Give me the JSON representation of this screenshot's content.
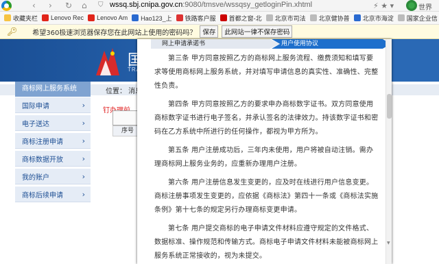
{
  "browser": {
    "url_host": "wssq.sbj.cnipa.gov.cn",
    "url_path": ":9080/tmsve/wssqsy_getloginPin.xhtml",
    "back": "‹",
    "forward": "›",
    "reload": "↻",
    "home": "⌂",
    "world_label": "世界"
  },
  "bookmarks": [
    {
      "label": "收藏夹栏",
      "color": "#f6c343"
    },
    {
      "label": "Lenovo Rec",
      "color": "#e1251b"
    },
    {
      "label": "Lenovo Am",
      "color": "#e1251b"
    },
    {
      "label": "Hao123_上",
      "color": "#2a6ad0"
    },
    {
      "label": "铁路客户服",
      "color": "#d33"
    },
    {
      "label": "首都之窗-北",
      "color": "#c00"
    },
    {
      "label": "北京市司法",
      "color": "#bbb"
    },
    {
      "label": "北京健协普",
      "color": "#bbb"
    },
    {
      "label": "北京市海淀",
      "color": "#2a6ad0"
    },
    {
      "label": "国家企业信",
      "color": "#bbb"
    },
    {
      "label": "北京市工商",
      "color": "#bbb"
    },
    {
      "label": "全国建筑市",
      "color": "#d33"
    }
  ],
  "password_bar": {
    "text": "希望360极速浏览器保存您在此网站上使用的密码吗？",
    "save_label": "保存",
    "never_label": "此网站一律不保存密码"
  },
  "site": {
    "title_fragment": "国",
    "subtitle_fragment": "TRA",
    "sidebar_title": "商标网上服务系统",
    "position_label": "位置： 消息",
    "red_title": "钉办理前",
    "table_head": "序号",
    "sidebar_items": [
      "国际申请",
      "电子送达",
      "商标注册申请",
      "商标数据开放",
      "我的账户",
      "商标后续申请"
    ]
  },
  "modal": {
    "tab_a": "网上申请承诺书",
    "tab_b": "用户使用协议",
    "paragraphs": [
      "第三条 甲方同意按照乙方的商标网上服务流程、缴费须知和填写要求等使用商标网上服务系统，并对填写申请信息的真实性、准确性、完整性负责。",
      "第四条 甲方同意按照乙方的要求申办商标数字证书。双方同意使用商标数字证书进行电子签名，并承认签名的法律效力。持该数字证书和密码在乙方系统中所进行的任何操作，都视为甲方所为。",
      "第五条 用户注册成功后，三年内未使用，用户将被自动注销。需办理商标网上服务业务的，应重新办理用户注册。",
      "第六条 用户注册信息发生变更的，应及时在线进行用户信息变更。商标注册事项发生变更的，应依据《商标法》第四十一条或《商标法实施条例》第十七条的规定另行办理商标变更申请。",
      "第七条 用户提交商标的电子申请文件材料应遵守规定的文件格式、数据标准、操作规范和传输方式。商标电子申请文件材料未能被商标网上服务系统正常接收的，视为未提交。"
    ]
  }
}
